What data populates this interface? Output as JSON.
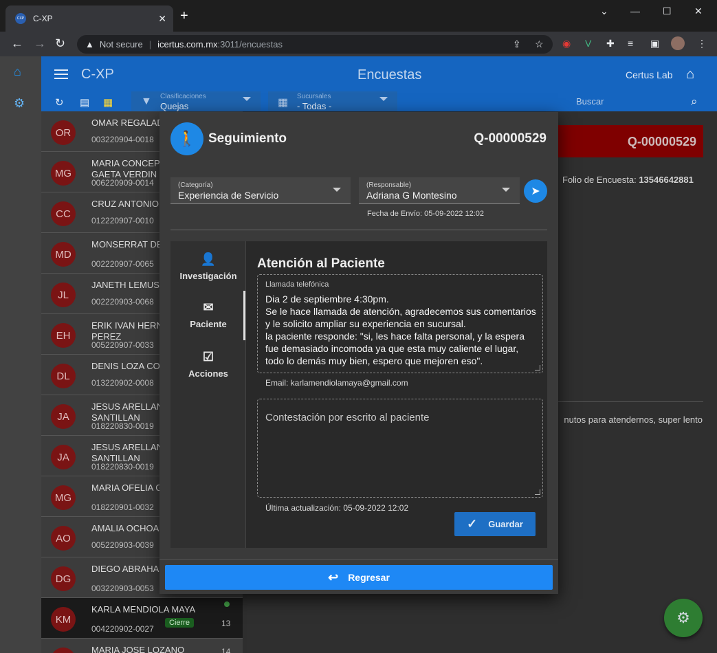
{
  "browser": {
    "tab_title": "C-XP",
    "tab_favicon": "CXP",
    "address_warning": "Not secure",
    "url_host": "icertus.com.mx",
    "url_path": ":3011/encuestas"
  },
  "app": {
    "brand": "C-XP",
    "page_title": "Encuestas",
    "user": "Certus Lab",
    "filters": {
      "clasificaciones_label": "Clasificaciones",
      "clasificaciones_value": "Quejas",
      "sucursales_label": "Sucursales",
      "sucursales_value": "- Todas -"
    },
    "search_placeholder": "Buscar"
  },
  "list": [
    {
      "initials": "OR",
      "name": "OMAR REGALADO",
      "folio": "003220904-0018"
    },
    {
      "initials": "MG",
      "name": "MARIA CONCEPCION GAETA VERDIN",
      "folio": "006220909-0014"
    },
    {
      "initials": "CC",
      "name": "CRUZ ANTONIO LOPEZ",
      "folio": "012220907-0010"
    },
    {
      "initials": "MD",
      "name": "MONSERRAT DE FLORES",
      "folio": "002220907-0065"
    },
    {
      "initials": "JL",
      "name": "JANETH LEMUS",
      "folio": "002220903-0068"
    },
    {
      "initials": "EH",
      "name": "ERIK IVAN HERNANDEZ PEREZ",
      "folio": "005220907-0033"
    },
    {
      "initials": "DL",
      "name": "DENIS LOZA CORTES",
      "folio": "013220902-0008"
    },
    {
      "initials": "JA",
      "name": "JESUS ARELLANO SANTILLAN",
      "folio": "018220830-0019"
    },
    {
      "initials": "JA",
      "name": "JESUS ARELLANO SANTILLAN",
      "folio": "018220830-0019"
    },
    {
      "initials": "MG",
      "name": "MARIA OFELIA G MORA",
      "folio": "018220901-0032"
    },
    {
      "initials": "AO",
      "name": "AMALIA OCHOA",
      "folio": "005220903-0039"
    },
    {
      "initials": "DG",
      "name": "DIEGO ABRAHAM BLANCO",
      "folio": "003220903-0053"
    },
    {
      "initials": "KM",
      "name": "KARLA MENDIOLA MAYA",
      "folio": "004220902-0027",
      "badge": "Cierre",
      "count": "13"
    },
    {
      "initials": "ML",
      "name": "MARIA JOSE LOZANO MEJIA",
      "folio": "",
      "count": "14"
    }
  ],
  "detail": {
    "folio": "Q-00000529",
    "folio_encuesta_label": "Folio de Encuesta:",
    "folio_encuesta_value": "13546642881",
    "comment_snippet": "nutos para atendernos, super lento"
  },
  "dialog": {
    "title": "Seguimiento",
    "folio": "Q-00000529",
    "categoria_label": "(Categoría)",
    "categoria_value": "Experiencia de Servicio",
    "responsable_label": "(Responsable)",
    "responsable_value": "Adriana G Montesino",
    "fecha_envio": "Fecha de Envío: 05-09-2022 12:02",
    "tabs": [
      "Investigación",
      "Paciente",
      "Acciones"
    ],
    "content_title": "Atención al Paciente",
    "llamada_label": "Llamada telefónica",
    "llamada_text": "Dia 2 de septiembre 4:30pm.\nSe le hace llamada de atención, agradecemos sus comentarios y le solicito ampliar su experiencia en sucursal.\nla paciente responde: \"si, les hace falta personal, y la espera fue demasiado incomoda ya que esta muy caliente el lugar, todo lo demás muy bien, espero que mejoren eso\".",
    "email": "Email: karlamendiolamaya@gmail.com",
    "respuesta_placeholder": "Contestación por escrito al paciente",
    "ultima_actualizacion": "Última actualización: 05-09-2022 12:02",
    "guardar": "Guardar",
    "regresar": "Regresar"
  },
  "colors": {
    "appbar": "#1565c0",
    "avatar": "#7a1414",
    "primary_button": "#1e88f5",
    "fab": "#2e7d32"
  }
}
